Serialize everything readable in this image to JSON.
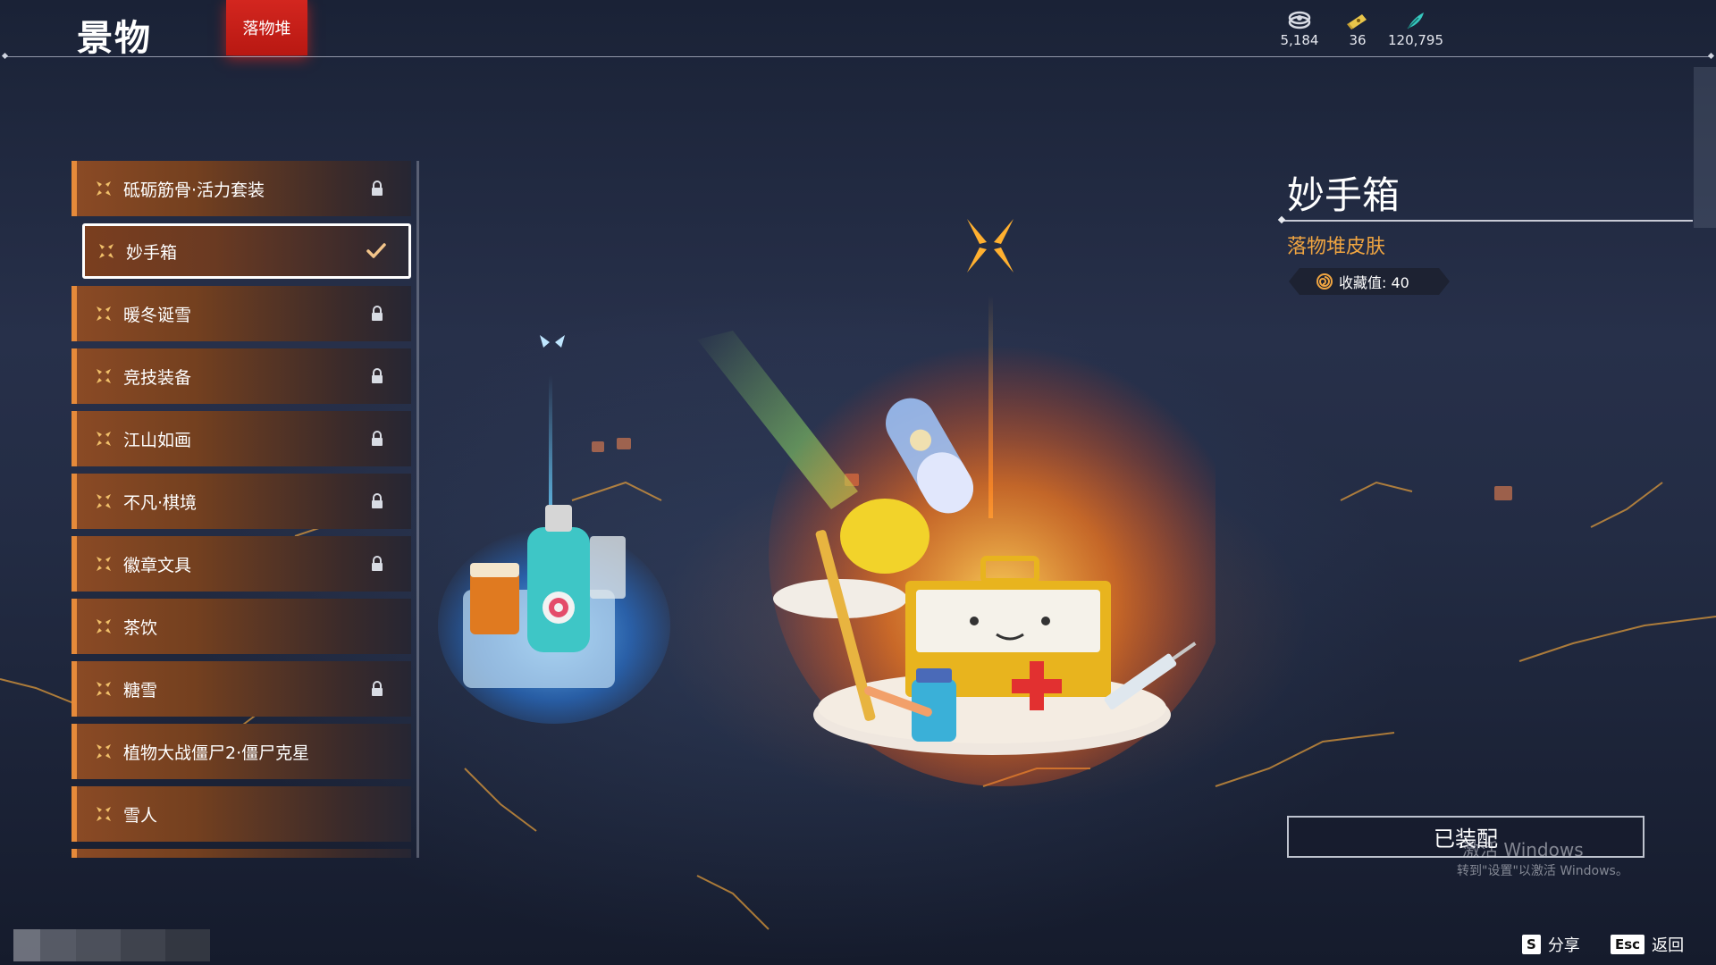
{
  "header": {
    "title": "景物",
    "active_tab": "落物堆",
    "currencies": [
      {
        "icon": "coin-stack-icon",
        "value": "5,184"
      },
      {
        "icon": "ticket-icon",
        "value": "36"
      },
      {
        "icon": "feather-icon",
        "value": "120,795"
      }
    ]
  },
  "list": {
    "items": [
      {
        "label": "砥砺筋骨·活力套装",
        "status": "locked"
      },
      {
        "label": "妙手箱",
        "status": "equipped"
      },
      {
        "label": "暖冬诞雪",
        "status": "locked"
      },
      {
        "label": "竞技装备",
        "status": "locked"
      },
      {
        "label": "江山如画",
        "status": "locked"
      },
      {
        "label": "不凡·棋境",
        "status": "locked"
      },
      {
        "label": "徽章文具",
        "status": "locked"
      },
      {
        "label": "茶饮",
        "status": "unlocked"
      },
      {
        "label": "糖雪",
        "status": "locked"
      },
      {
        "label": "植物大战僵尸2·僵尸克星",
        "status": "unlocked"
      },
      {
        "label": "雪人",
        "status": "unlocked"
      }
    ]
  },
  "detail": {
    "title": "妙手箱",
    "subtitle": "落物堆皮肤",
    "collect_value": "收藏值: 40",
    "equip_label": "已装配"
  },
  "watermark": {
    "title": "激活 Windows",
    "subtitle": "转到\"设置\"以激活 Windows。"
  },
  "hints": {
    "share_key": "S",
    "share_label": "分享",
    "back_key": "Esc",
    "back_label": "返回"
  },
  "colors": {
    "accent_red": "#d3261f",
    "accent_orange": "#f0a541",
    "item_border": "#e68a3a"
  }
}
